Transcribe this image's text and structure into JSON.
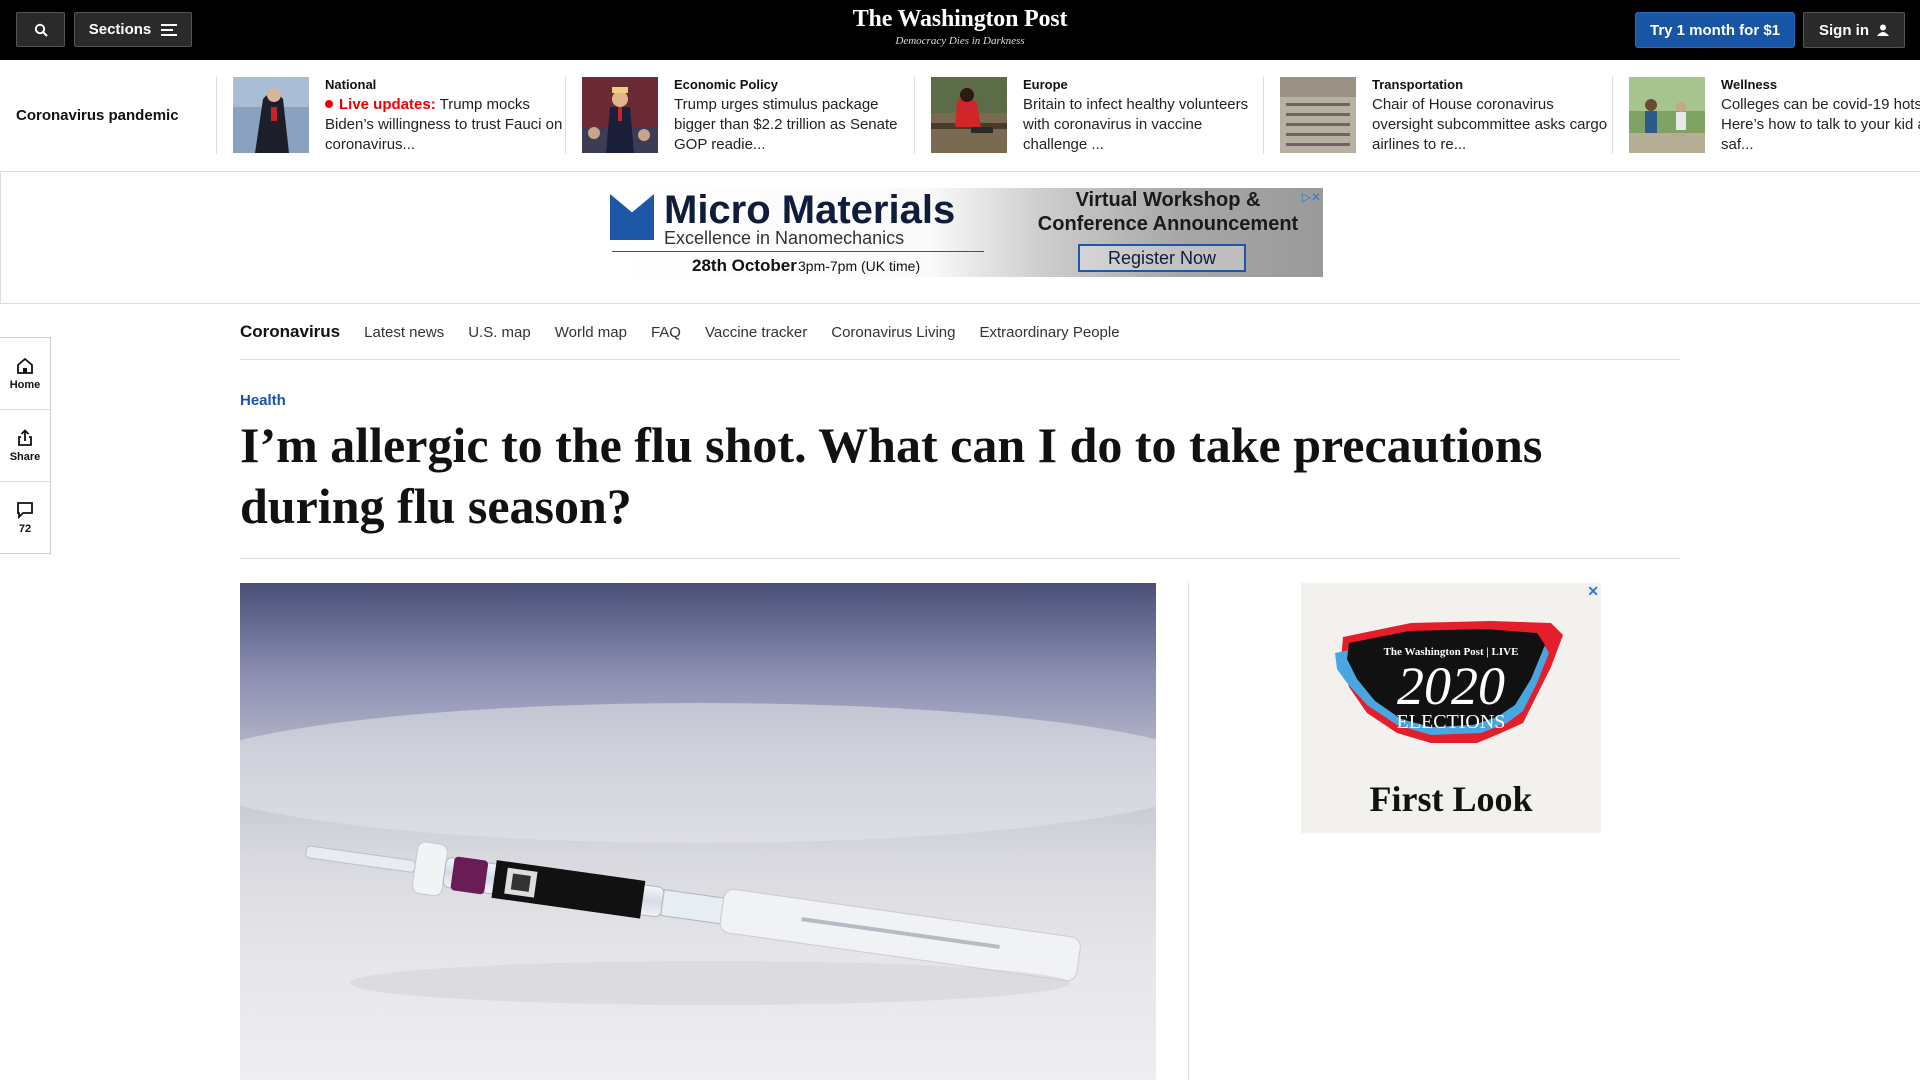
{
  "header": {
    "sections_label": "Sections",
    "logo": "The Washington Post",
    "tagline": "Democracy Dies in Darkness",
    "try_label": "Try 1 month for $1",
    "signin_label": "Sign in"
  },
  "strip": {
    "title": "Coronavirus pandemic",
    "stories": [
      {
        "category": "National",
        "live_label": "Live updates:",
        "headline": "Trump mocks Biden’s willingness to trust Fauci on coronavirus..."
      },
      {
        "category": "Economic Policy",
        "headline": "Trump urges stimulus package bigger than $2.2 trillion as Senate GOP readie..."
      },
      {
        "category": "Europe",
        "headline": "Britain to infect healthy volunteers with coronavirus in vaccine challenge ..."
      },
      {
        "category": "Transportation",
        "headline": "Chair of House coronavirus oversight subcommittee asks cargo airlines to re..."
      },
      {
        "category": "Wellness",
        "headline": "Colleges can be covid-19 hotspots. Here’s how to talk to your kid about saf..."
      }
    ]
  },
  "ad_banner": {
    "brand": "Micro Materials",
    "subtitle": "Excellence in Nanomechanics",
    "date": "28th October",
    "time": "3pm-7pm (UK time)",
    "headline": "Virtual Workshop & Conference Announcement",
    "cta": "Register Now"
  },
  "section_nav": {
    "active": "Coronavirus",
    "links": [
      "Latest news",
      "U.S. map",
      "World map",
      "FAQ",
      "Vaccine tracker",
      "Coronavirus Living",
      "Extraordinary People"
    ]
  },
  "rail": {
    "home": "Home",
    "share": "Share",
    "comments": "72"
  },
  "article": {
    "kicker": "Health",
    "headline": "I’m allergic to the flu shot. What can I do to take precautions during flu season?"
  },
  "side_ad": {
    "publisher": "The Washington Post | LIVE",
    "year": "2020",
    "label": "ELECTIONS",
    "cta": "First Look"
  },
  "colors": {
    "accent": "#1955a5",
    "live": "#e00000",
    "topbar": "#000000"
  }
}
